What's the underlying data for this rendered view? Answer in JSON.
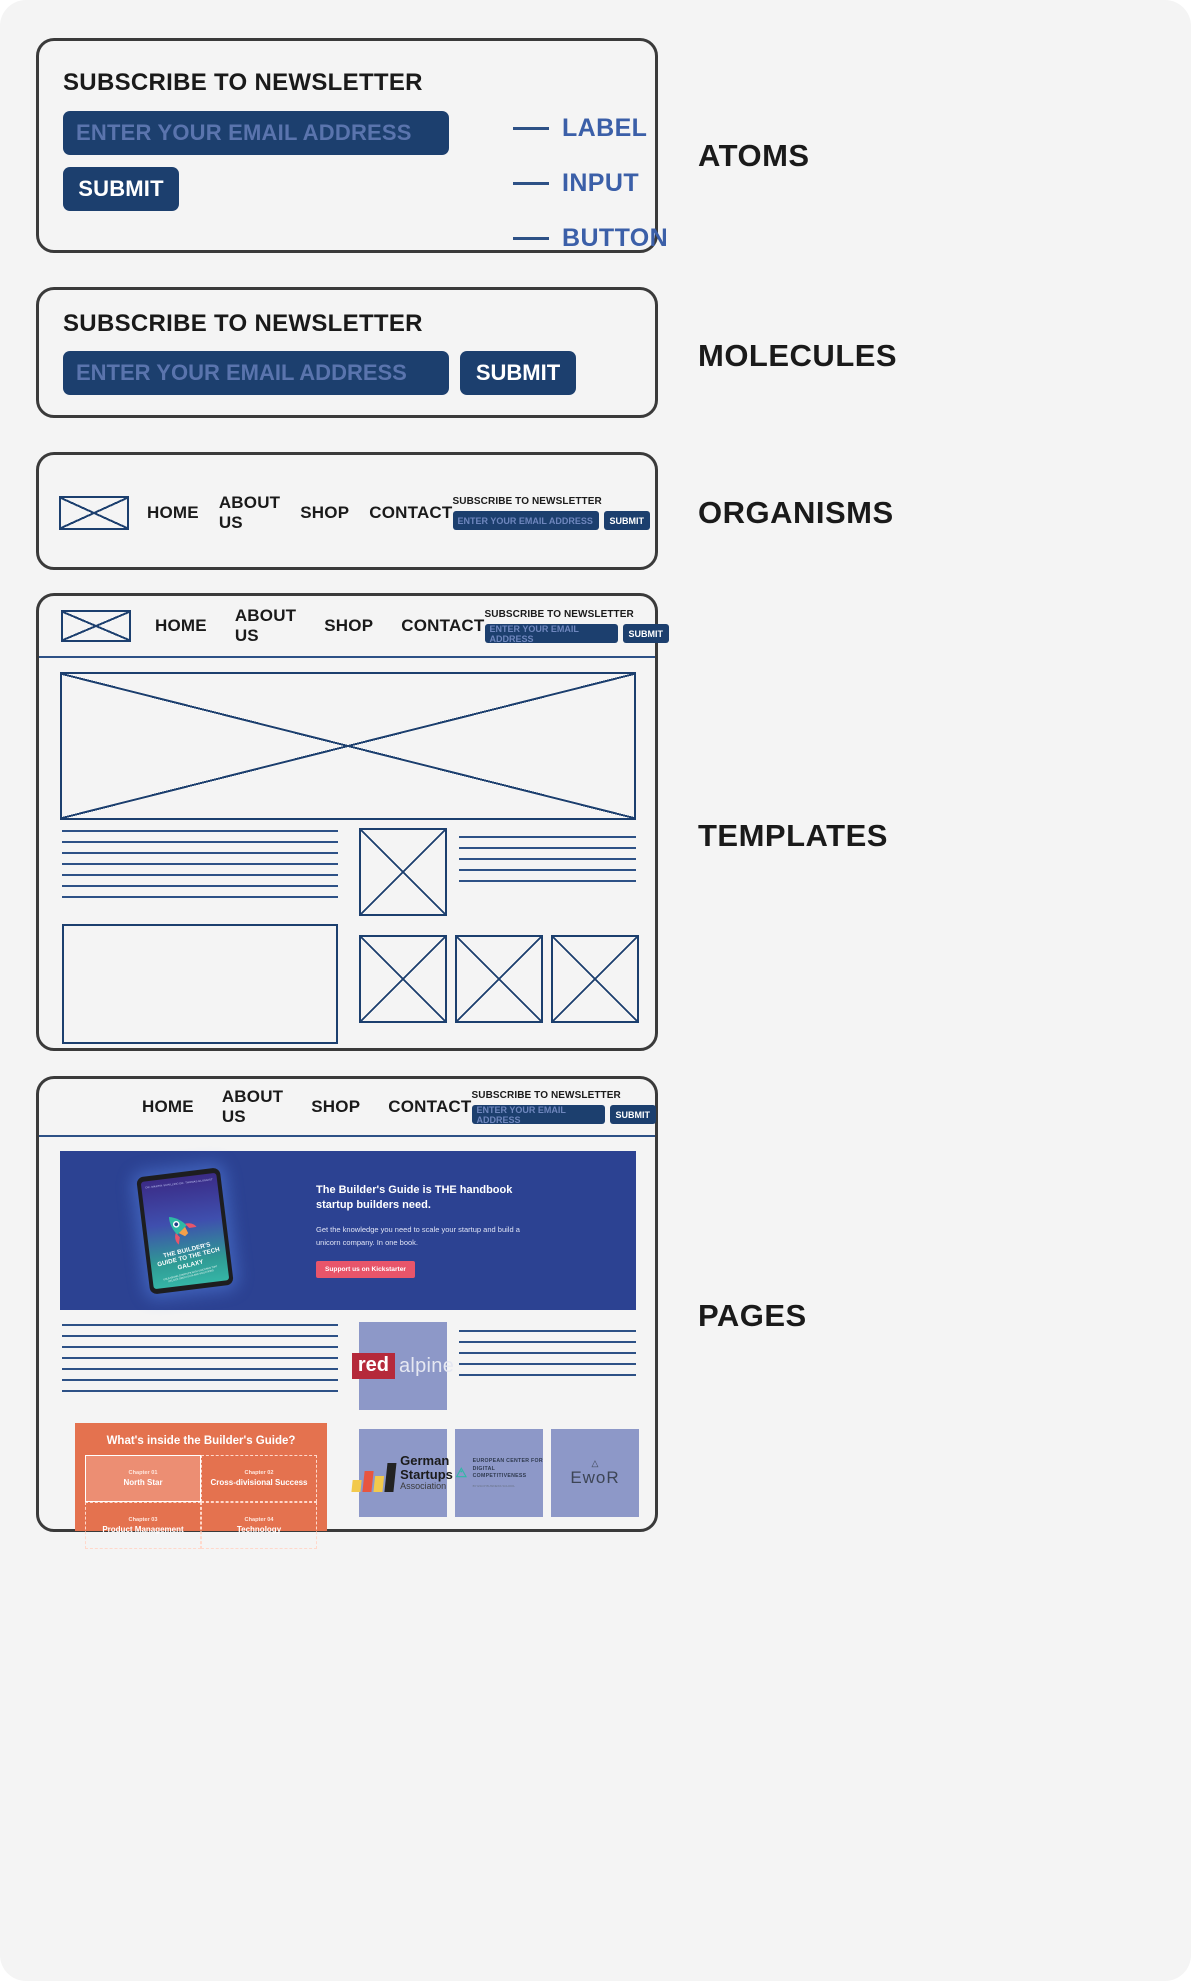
{
  "newsletter": {
    "title": "SUBSCRIBE TO NEWSLETTER",
    "input_placeholder": "ENTER YOUR EMAIL ADDRESS",
    "submit_label": "SUBMIT"
  },
  "sections": {
    "atoms": "ATOMS",
    "molecules": "MOLECULES",
    "organisms": "ORGANISMS",
    "templates": "TEMPLATES",
    "pages": "PAGES"
  },
  "atoms_legend": [
    {
      "label": "LABEL"
    },
    {
      "label": "INPUT"
    },
    {
      "label": "BUTTON"
    }
  ],
  "nav": {
    "items": [
      "HOME",
      "ABOUT US",
      "SHOP",
      "CONTACT"
    ]
  },
  "hero": {
    "heading": "The Builder's Guide is THE handbook startup builders need.",
    "body": "Get the knowledge you need to scale your startup and build a unicorn company. In one book.",
    "cta": "Support us on Kickstarter",
    "book_title": "THE BUILDER'S GUIDE TO THE TECH GALAXY",
    "book_sub": "UNLEASHING STARTUPS WITH UNICORNS THAT DELIVER GREAT DATA AND VALUATIONS",
    "book_author_1": "DR. MARTIN SCHILLING",
    "book_author_2": "DR. THOMAS KLUGKIST"
  },
  "redalpine": {
    "word_1": "red",
    "word_2": "alpine"
  },
  "chapters_box": {
    "title": "What's inside the Builder's Guide?",
    "items": [
      {
        "num": "Chapter 01",
        "name": "North Star",
        "active": true
      },
      {
        "num": "Chapter 02",
        "name": "Cross-divisional Success",
        "active": false
      },
      {
        "num": "Chapter 03",
        "name": "Product Management",
        "active": false
      },
      {
        "num": "Chapter 04",
        "name": "Technology",
        "active": false
      }
    ]
  },
  "partners": {
    "gsa": {
      "line1": "German",
      "line2": "Startups",
      "line3": "Association"
    },
    "ecdc": {
      "line1": "EUROPEAN CENTER FOR",
      "line2": "DIGITAL COMPETITIVENESS",
      "line3": "BY ESCP BUSINESS SCHOOL"
    },
    "ewor": {
      "name": "EwoR"
    }
  },
  "colors": {
    "navy": "#1c3f6e",
    "wire_blue": "#2d5186",
    "legend_blue": "#3b5fa8",
    "hero_blue": "#2c4292",
    "cta_red": "#e8556a",
    "orange": "#e4724f",
    "periwinkle": "#8d98c8",
    "page_bg": "#f4f4f4",
    "card_border": "#3a3a3a"
  }
}
